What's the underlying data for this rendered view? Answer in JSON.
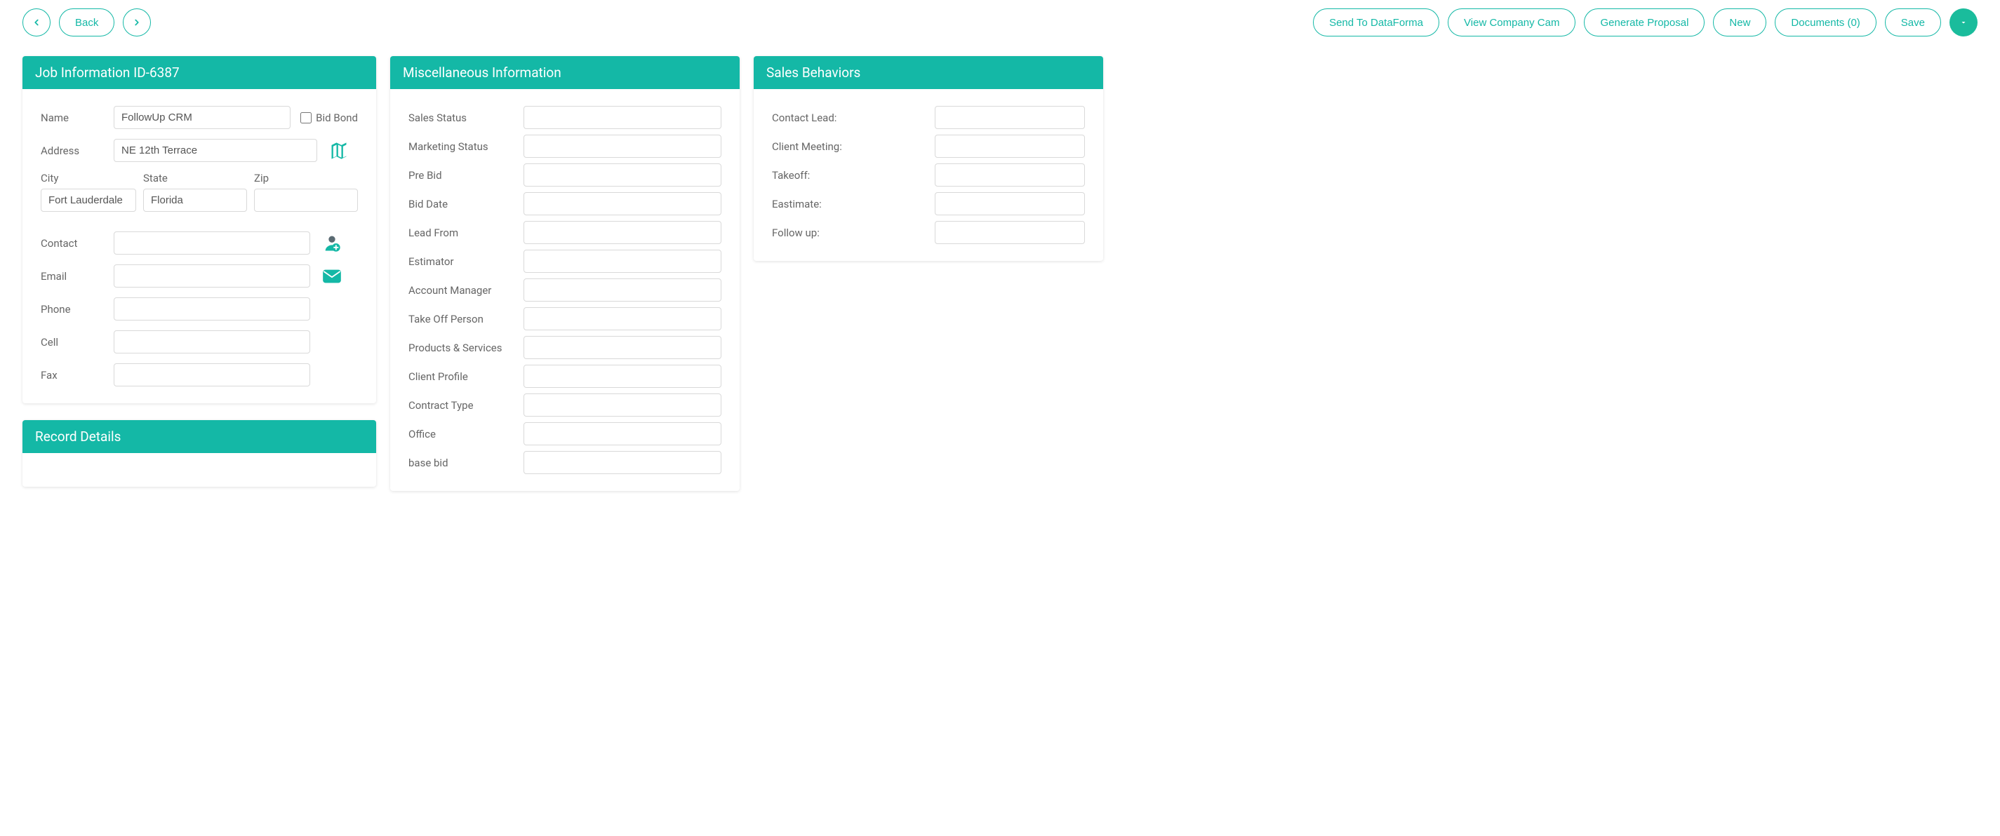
{
  "colors": {
    "accent": "#14b8a6"
  },
  "topbar": {
    "back_label": "Back",
    "send_dataforma": "Send To DataForma",
    "view_company_cam": "View Company Cam",
    "generate_proposal": "Generate Proposal",
    "new_label": "New",
    "documents_label": "Documents (0)",
    "save_label": "Save"
  },
  "job_info": {
    "panel_title": "Job Information ID-6387",
    "labels": {
      "name": "Name",
      "bid_bond": "Bid Bond",
      "address": "Address",
      "city": "City",
      "state": "State",
      "zip": "Zip",
      "contact": "Contact",
      "email": "Email",
      "phone": "Phone",
      "cell": "Cell",
      "fax": "Fax"
    },
    "values": {
      "name": "FollowUp CRM",
      "address": "NE 12th Terrace",
      "city": "Fort Lauderdale",
      "state": "Florida",
      "zip": "",
      "contact": "",
      "email": "",
      "phone": "",
      "cell": "",
      "fax": ""
    }
  },
  "record_details": {
    "panel_title": "Record Details"
  },
  "misc": {
    "panel_title": "Miscellaneous Information",
    "labels": {
      "sales_status": "Sales Status",
      "marketing_status": "Marketing Status",
      "pre_bid": "Pre Bid",
      "bid_date": "Bid Date",
      "lead_from": "Lead From",
      "estimator": "Estimator",
      "account_manager": "Account Manager",
      "take_off_person": "Take Off Person",
      "products_services": "Products & Services",
      "client_profile": "Client Profile",
      "contract_type": "Contract Type",
      "office": "Office",
      "base_bid": "base bid"
    },
    "values": {
      "sales_status": "",
      "marketing_status": "",
      "pre_bid": "",
      "bid_date": "",
      "lead_from": "",
      "estimator": "",
      "account_manager": "",
      "take_off_person": "",
      "products_services": "",
      "client_profile": "",
      "contract_type": "",
      "office": "",
      "base_bid": ""
    }
  },
  "sales": {
    "panel_title": "Sales Behaviors",
    "labels": {
      "contact_lead": "Contact Lead:",
      "client_meeting": "Client Meeting:",
      "takeoff": "Takeoff:",
      "estimate": "Eastimate:",
      "follow_up": "Follow up:"
    },
    "values": {
      "contact_lead": "",
      "client_meeting": "",
      "takeoff": "",
      "estimate": "",
      "follow_up": ""
    }
  }
}
